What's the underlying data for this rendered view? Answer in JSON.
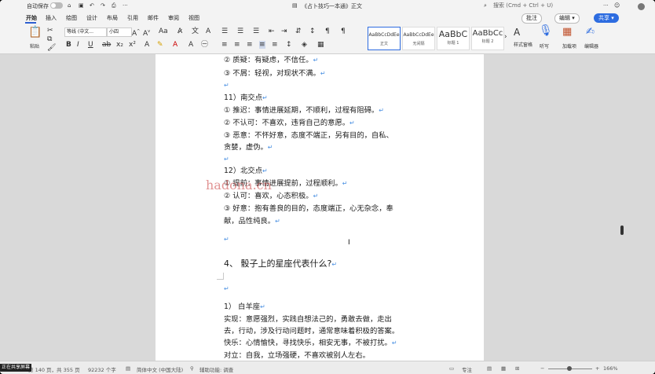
{
  "titlebar": {
    "autosave_label": "自动保存",
    "document_title": "《占卜技巧一本通》正文",
    "search_placeholder": "搜索 (Cmd + Ctrl + U)"
  },
  "menubar": {
    "items": [
      "开始",
      "插入",
      "绘图",
      "设计",
      "布局",
      "引用",
      "邮件",
      "审阅",
      "视图"
    ],
    "comment_label": "批注",
    "edit_label": "编辑",
    "share_label": "共享"
  },
  "ribbon": {
    "paste_label": "粘贴",
    "font_name": "等线 (中文...",
    "font_size": "小四",
    "styles": [
      {
        "sample": "AaBbCcDdEe",
        "name": "正文"
      },
      {
        "sample": "AaBbCcDdEe",
        "name": "无间隔"
      },
      {
        "sample": "AaBbC",
        "name": "标题 1"
      },
      {
        "sample": "AaBbCc",
        "name": "标题 2"
      }
    ],
    "styles_pane_label": "样式窗格",
    "dictate_label": "听写",
    "addins_label": "加载项",
    "editor_label": "编辑器"
  },
  "document": {
    "lines": [
      "② 质疑：有疑虑，不信任。",
      "③ 不屑：轻视，对现状不满。",
      "",
      "11）南交点",
      "① 推迟：事情进展延期，不顺利，过程有阻碍。",
      "② 不认可：不喜欢，违背自己的意愿。",
      "③ 恶意：不怀好意，态度不端正，另有目的，自私、",
      "贪婪，虚伪。",
      "",
      "12）北交点",
      "① 提前：事情进展提前，过程顺利。",
      "② 认可：喜欢，心态积极。",
      "③ 好意：抱有善良的目的，态度端正，心无杂念，奉",
      "献，品性纯良。",
      "",
      "4、 骰子上的星座代表什么?",
      "",
      "1） 白羊座",
      "实现：意愿强烈，实践自想法己的，勇敢去做，走出",
      "去，行动，涉及行动问题时，通常意味着积极的答案。",
      "快乐：心情愉快，寻找快乐，相安无事，不被打扰。",
      "对立：自我，立场强硬，不喜欢被别人左右。"
    ],
    "watermark": "hadona.cn"
  },
  "statusbar": {
    "page_info": "第 140 页，共 355 页",
    "word_count": "92232 个字",
    "language": "简体中文 (中国大陆)",
    "accessibility": "辅助功能: 调查",
    "focus_label": "专注",
    "zoom": "166%",
    "sharing_badge": "正在共享屏幕"
  }
}
